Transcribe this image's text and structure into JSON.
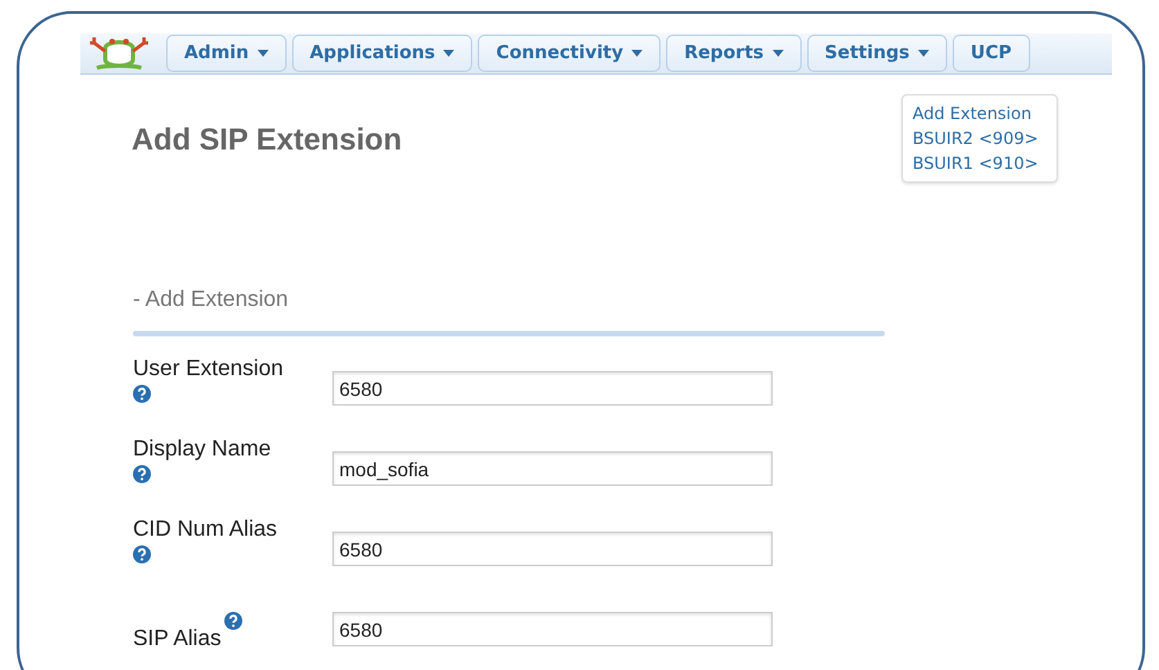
{
  "nav": {
    "menus": [
      {
        "label": "Admin",
        "dropdown": true
      },
      {
        "label": "Applications",
        "dropdown": true
      },
      {
        "label": "Connectivity",
        "dropdown": true
      },
      {
        "label": "Reports",
        "dropdown": true
      },
      {
        "label": "Settings",
        "dropdown": true
      },
      {
        "label": "UCP",
        "dropdown": false
      }
    ]
  },
  "page_title": "Add SIP Extension",
  "side_menu": [
    "Add Extension",
    "BSUIR2 <909>",
    "BSUIR1 <910>"
  ],
  "section_heading": "- Add Extension",
  "fields": [
    {
      "label": "User Extension",
      "value": "6580",
      "kind": "stacked"
    },
    {
      "label": "Display Name",
      "value": "mod_sofia",
      "kind": "stacked"
    },
    {
      "label": "CID Num Alias",
      "value": "6580",
      "kind": "stacked"
    },
    {
      "label": "SIP Alias",
      "value": "6580",
      "kind": "inline"
    }
  ]
}
